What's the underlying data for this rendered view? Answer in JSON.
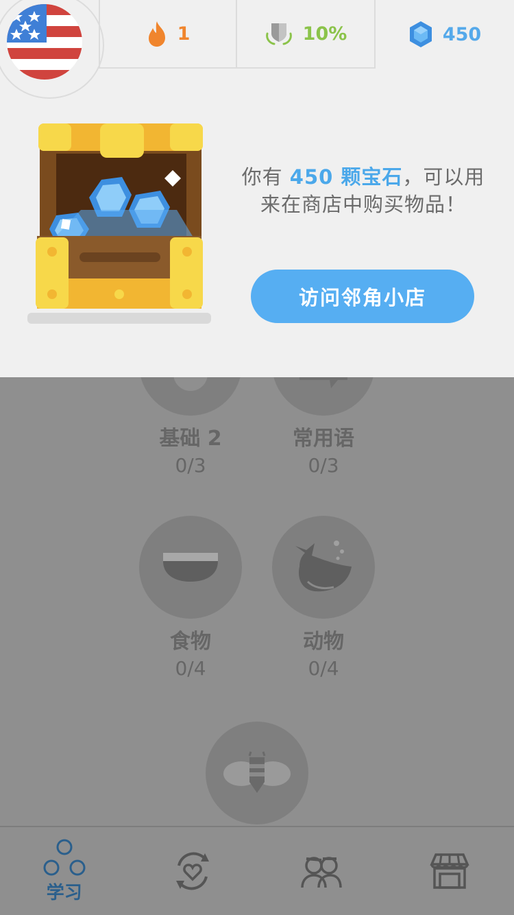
{
  "stats": {
    "streak": "1",
    "crown_percent": "10%",
    "gems": "450"
  },
  "promo": {
    "text_pre": "你有 ",
    "text_gems": "450 颗宝石",
    "text_post": "，可以用来在商店中购买物品！",
    "button_label": "访问邻角小店"
  },
  "skills": [
    {
      "name": "基础 2",
      "progress": "0/3"
    },
    {
      "name": "常用语",
      "progress": "0/3"
    },
    {
      "name": "食物",
      "progress": "0/4"
    },
    {
      "name": "动物",
      "progress": "0/4"
    }
  ],
  "nav": {
    "learn_label": "学习"
  },
  "colors": {
    "streak": "#f0852d",
    "crown": "#8bc34a",
    "gems": "#55a9ea",
    "button": "#56aef2",
    "nav_active": "#2a5f8c"
  },
  "icons": [
    "us-flag-icon",
    "flame-icon",
    "crown-shield-icon",
    "gem-icon",
    "treasure-chest-icon",
    "learn-icon",
    "practice-heart-icon",
    "friends-icon",
    "shop-icon"
  ]
}
